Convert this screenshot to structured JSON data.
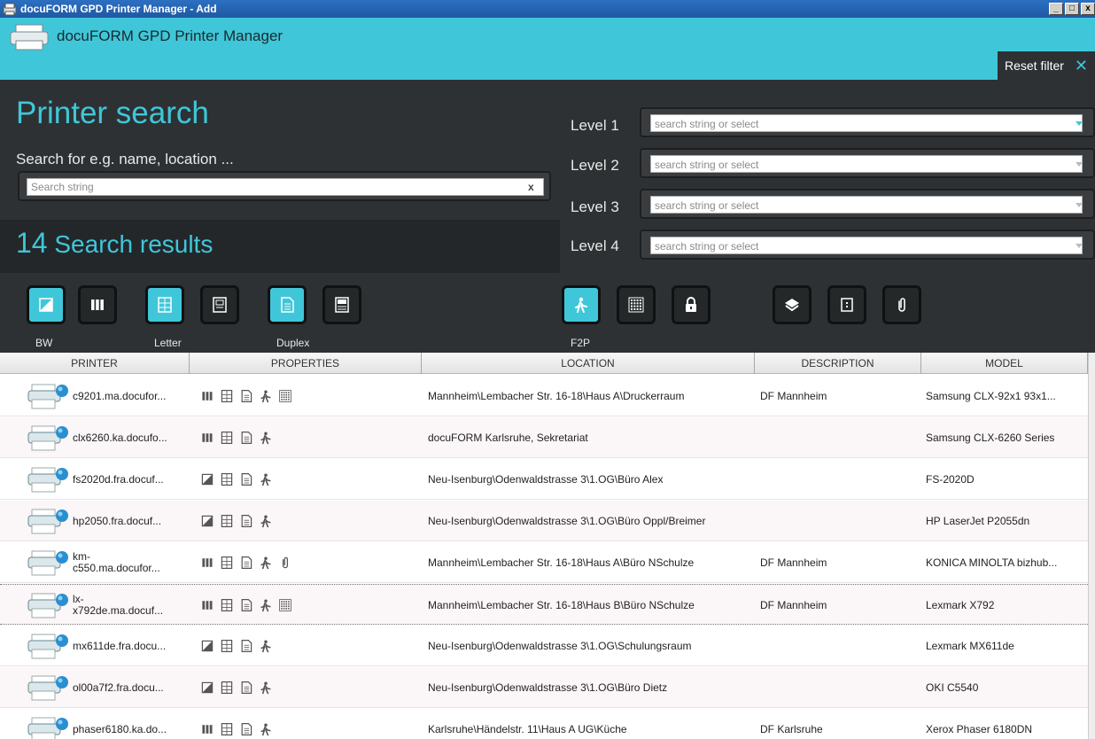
{
  "window": {
    "title": "docuFORM GPD Printer Manager - Add",
    "min": "_",
    "max": "□",
    "close": "x"
  },
  "header": {
    "app_title": "docuFORM GPD Printer Manager",
    "reset_filter": "Reset filter",
    "reset_icon": "close-icon"
  },
  "search": {
    "title": "Printer search",
    "hint": "Search for e.g. name, location ...",
    "placeholder": "Search string",
    "value": "",
    "clear": "x",
    "results_count": "14",
    "results_label": "Search results"
  },
  "levels": [
    {
      "label": "Level 1",
      "placeholder": "search string or select"
    },
    {
      "label": "Level 2",
      "placeholder": "search string or select"
    },
    {
      "label": "Level 3",
      "placeholder": "search string or select"
    },
    {
      "label": "Level 4",
      "placeholder": "search string or select"
    }
  ],
  "filters": [
    {
      "icon": "bw-icon",
      "label": "BW",
      "active": true
    },
    {
      "icon": "color-bars-icon",
      "label": "",
      "active": false
    },
    {
      "icon": "letter-icon",
      "label": "Letter",
      "active": true
    },
    {
      "icon": "a4-icon",
      "label": "",
      "active": false
    },
    {
      "icon": "duplex-icon",
      "label": "Duplex",
      "active": true
    },
    {
      "icon": "simplex-icon",
      "label": "",
      "active": false
    },
    {
      "icon": "f2p-icon",
      "label": "F2P",
      "active": true
    },
    {
      "icon": "keypad-icon",
      "label": "",
      "active": false
    },
    {
      "icon": "lock-icon",
      "label": "",
      "active": false
    },
    {
      "icon": "layers-icon",
      "label": "",
      "active": false
    },
    {
      "icon": "card-icon",
      "label": "",
      "active": false
    },
    {
      "icon": "paperclip-icon",
      "label": "",
      "active": false
    }
  ],
  "table": {
    "columns": [
      "PRINTER",
      "PROPERTIES",
      "LOCATION",
      "DESCRIPTION",
      "MODEL"
    ],
    "rows": [
      {
        "printer": "c9201.ma.docufor...",
        "props": [
          "color-bars-icon",
          "letter-icon",
          "duplex-icon",
          "f2p-icon",
          "keypad-icon"
        ],
        "location": "Mannheim\\Lembacher Str. 16-18\\Haus A\\Druckerraum",
        "description": "DF Mannheim",
        "model": "Samsung CLX-92x1 93x1..."
      },
      {
        "printer": "clx6260.ka.docufo...",
        "props": [
          "color-bars-icon",
          "letter-icon",
          "duplex-icon",
          "f2p-icon"
        ],
        "location": "docuFORM Karlsruhe, Sekretariat",
        "description": "",
        "model": "Samsung CLX-6260 Series"
      },
      {
        "printer": "fs2020d.fra.docuf...",
        "props": [
          "bw-icon",
          "letter-icon",
          "duplex-icon",
          "f2p-icon"
        ],
        "location": "Neu-Isenburg\\Odenwaldstrasse 3\\1.OG\\Büro Alex",
        "description": "",
        "model": "FS-2020D"
      },
      {
        "printer": "hp2050.fra.docuf...",
        "props": [
          "bw-icon",
          "letter-icon",
          "duplex-icon",
          "f2p-icon"
        ],
        "location": "Neu-Isenburg\\Odenwaldstrasse 3\\1.OG\\Büro Oppl/Breimer",
        "description": "",
        "model": "HP LaserJet P2055dn"
      },
      {
        "printer": "km-\nc550.ma.docufor...",
        "props": [
          "color-bars-icon",
          "letter-icon",
          "duplex-icon",
          "f2p-icon",
          "paperclip-icon"
        ],
        "location": "Mannheim\\Lembacher Str. 16-18\\Haus A\\Büro NSchulze",
        "description": "DF Mannheim",
        "model": "KONICA MINOLTA bizhub..."
      },
      {
        "printer": "lx-\nx792de.ma.docuf...",
        "props": [
          "color-bars-icon",
          "letter-icon",
          "duplex-icon",
          "f2p-icon",
          "keypad-icon"
        ],
        "location": "Mannheim\\Lembacher Str. 16-18\\Haus B\\Büro NSchulze",
        "description": "DF Mannheim",
        "model": "Lexmark X792"
      },
      {
        "printer": "mx611de.fra.docu...",
        "props": [
          "bw-icon",
          "letter-icon",
          "duplex-icon",
          "f2p-icon"
        ],
        "location": "Neu-Isenburg\\Odenwaldstrasse 3\\1.OG\\Schulungsraum",
        "description": "",
        "model": "Lexmark MX611de"
      },
      {
        "printer": "ol00a7f2.fra.docu...",
        "props": [
          "bw-icon",
          "letter-icon",
          "duplex-icon",
          "f2p-icon"
        ],
        "location": "Neu-Isenburg\\Odenwaldstrasse 3\\1.OG\\Büro Dietz",
        "description": "",
        "model": "OKI C5540"
      },
      {
        "printer": "phaser6180.ka.do...",
        "props": [
          "color-bars-icon",
          "letter-icon",
          "duplex-icon",
          "f2p-icon"
        ],
        "location": "Karlsruhe\\Händelstr. 11\\Haus A UG\\Küche",
        "description": "DF Karlsruhe",
        "model": "Xerox Phaser 6180DN"
      }
    ]
  },
  "colors": {
    "accent": "#3fc7d9",
    "panel": "#2e3133",
    "titlebar": "#1f58a3"
  }
}
